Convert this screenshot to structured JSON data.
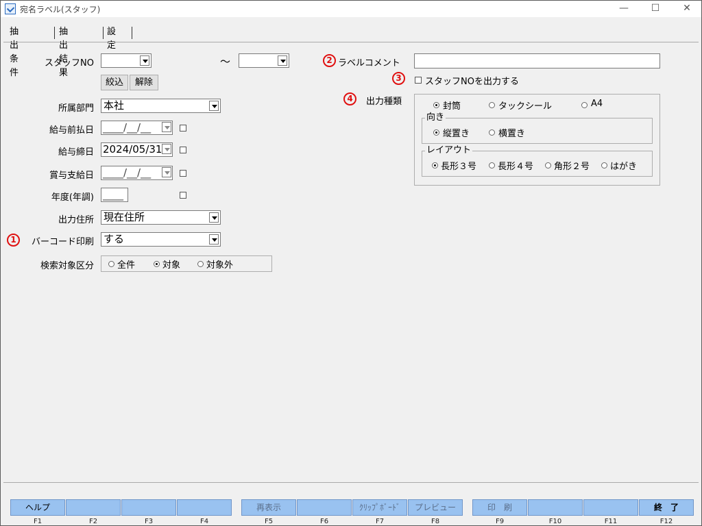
{
  "window": {
    "title": "宛名ラベル(スタッフ)",
    "controls": [
      "—",
      "☐",
      "✕"
    ]
  },
  "tabs": [
    {
      "label": "抽出条件"
    },
    {
      "label": "抽出結果"
    },
    {
      "label": "設定"
    }
  ],
  "form": {
    "staff_no": {
      "label": "スタッフNO",
      "from": "",
      "tilde": "～",
      "to": ""
    },
    "buttons": {
      "narrow": "絞込",
      "release": "解除"
    },
    "department": {
      "label": "所属部門",
      "value": "本社"
    },
    "salary_advance_date": {
      "label": "給与前払日",
      "value": "____/__/__"
    },
    "salary_close_date": {
      "label": "給与締日",
      "value": "2024/05/31"
    },
    "bonus_pay_date": {
      "label": "賞与支給日",
      "value": "____/__/__"
    },
    "fiscal_year": {
      "label": "年度(年調)",
      "value": "____"
    },
    "output_address": {
      "label": "出力住所",
      "value": "現在住所"
    },
    "barcode_print": {
      "marker": "1",
      "label": "バーコード印刷",
      "value": "する"
    },
    "search_target": {
      "label": "検索対象区分",
      "options": [
        "全件",
        "対象",
        "対象外"
      ],
      "selected": "対象"
    }
  },
  "right": {
    "label_comment": {
      "marker": "2",
      "label": "ラベルコメント",
      "value": ""
    },
    "print_staff_no": {
      "marker": "3",
      "label": "スタッフNOを出力する",
      "checked": false
    },
    "output_type": {
      "marker": "4",
      "label": "出力種類",
      "options": [
        "封筒",
        "タックシール",
        "A4"
      ],
      "selected": "封筒",
      "orientation": {
        "title": "向き",
        "options": [
          "縦置き",
          "横置き"
        ],
        "selected": "縦置き"
      },
      "layout": {
        "title": "レイアウト",
        "options": [
          "長形３号",
          "長形４号",
          "角形２号",
          "はがき"
        ],
        "selected": "長形３号"
      }
    }
  },
  "fkeys": [
    {
      "key": "F1",
      "label": "ヘルプ"
    },
    {
      "key": "F2",
      "label": ""
    },
    {
      "key": "F3",
      "label": ""
    },
    {
      "key": "F4",
      "label": ""
    },
    {
      "key": "F5",
      "label": "再表示"
    },
    {
      "key": "F6",
      "label": ""
    },
    {
      "key": "F7",
      "label": "ｸﾘｯﾌﾟﾎﾞｰﾄﾞ"
    },
    {
      "key": "F8",
      "label": "プレビュー"
    },
    {
      "key": "F9",
      "label": "印　刷"
    },
    {
      "key": "F10",
      "label": ""
    },
    {
      "key": "F11",
      "label": ""
    },
    {
      "key": "F12",
      "label": "終　了"
    }
  ],
  "colors": {
    "fkey_bg": "#99c2f0",
    "marker": "#e01010"
  }
}
